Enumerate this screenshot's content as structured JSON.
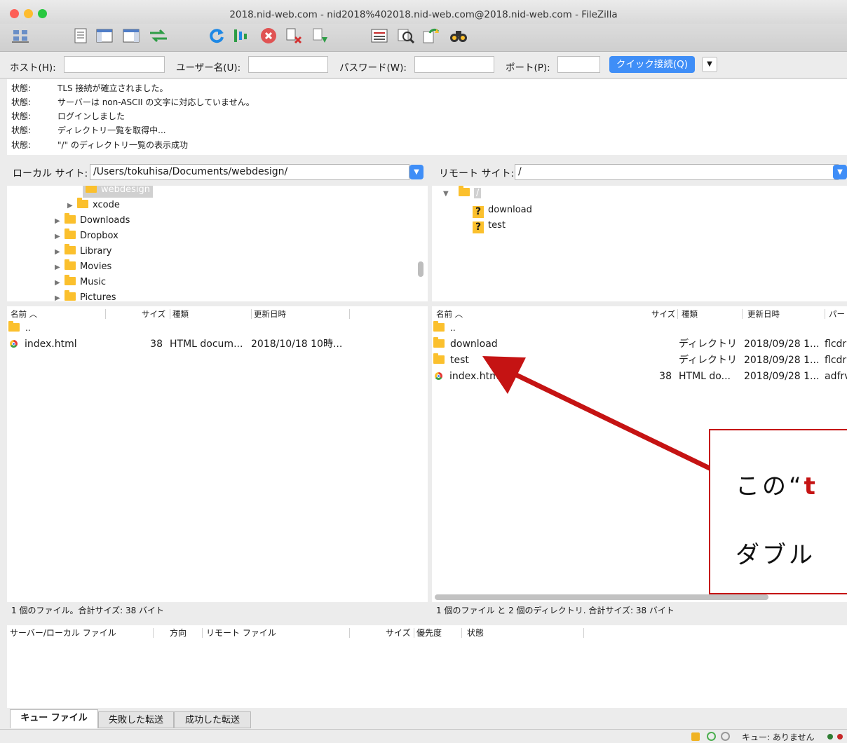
{
  "window": {
    "title": "2018.nid-web.com - nid2018%402018.nid-web.com@2018.nid-web.com - FileZilla"
  },
  "toolbar": {
    "icons": [
      "site-manager-icon",
      "toggle-log-icon",
      "toggle-local-tree-icon",
      "toggle-remote-tree-icon",
      "toggle-queue-icon",
      "refresh-icon",
      "process-queue-icon",
      "cancel-icon",
      "disconnect-icon",
      "reconnect-icon",
      "filter-icon",
      "compare-icon",
      "sync-browse-icon",
      "search-icon"
    ]
  },
  "quickconnect": {
    "host_label": "ホスト(H):",
    "user_label": "ユーザー名(U):",
    "password_label": "パスワード(W):",
    "port_label": "ポート(P):",
    "host_value": "",
    "user_value": "",
    "password_value": "",
    "port_value": "",
    "button_label": "クイック接続(Q)"
  },
  "log": [
    {
      "key": "状態:",
      "text": "TLS 接続が確立されました。"
    },
    {
      "key": "状態:",
      "text": "サーバーは non-ASCII の文字に対応していません。"
    },
    {
      "key": "状態:",
      "text": "ログインしました"
    },
    {
      "key": "状態:",
      "text": "ディレクトリ一覧を取得中..."
    },
    {
      "key": "状態:",
      "text": "\"/\" のディレクトリ一覧の表示成功"
    }
  ],
  "local": {
    "site_label": "ローカル サイト:",
    "site_path": "/Users/tokuhisa/Documents/webdesign/",
    "tree": [
      "webdesign",
      "xcode",
      "Downloads",
      "Dropbox",
      "Library",
      "Movies",
      "Music",
      "Pictures"
    ],
    "columns": {
      "name": "名前",
      "size": "サイズ",
      "type": "種類",
      "modified": "更新日時"
    },
    "files": [
      {
        "name": "..",
        "size": "",
        "type": "",
        "modified": ""
      },
      {
        "name": "index.html",
        "size": "38",
        "type": "HTML docum...",
        "modified": "2018/10/18 10時..."
      }
    ],
    "status": "1 個のファイル。合計サイズ: 38 バイト"
  },
  "remote": {
    "site_label": "リモート サイト:",
    "site_path": "/",
    "tree_root": "/",
    "tree": [
      "download",
      "test"
    ],
    "columns": {
      "name": "名前",
      "size": "サイズ",
      "type": "種類",
      "modified": "更新日時",
      "perm": "パー"
    },
    "files": [
      {
        "name": "..",
        "size": "",
        "type": "",
        "modified": "",
        "perm": ""
      },
      {
        "name": "download",
        "size": "",
        "type": "ディレクトリ",
        "modified": "2018/09/28 1...",
        "perm": "flcdr"
      },
      {
        "name": "test",
        "size": "",
        "type": "ディレクトリ",
        "modified": "2018/09/28 1...",
        "perm": "flcdr"
      },
      {
        "name": "index.html",
        "size": "38",
        "type": "HTML do...",
        "modified": "2018/09/28 1...",
        "perm": "adfrv"
      }
    ],
    "status": "1 個のファイル と 2 個のディレクトリ. 合計サイズ: 38 バイト"
  },
  "queue": {
    "columns": {
      "file": "サーバー/ローカル ファイル",
      "direction": "方向",
      "remote": "リモート ファイル",
      "size": "サイズ",
      "priority": "優先度",
      "status": "状態"
    },
    "tabs": [
      "キュー ファイル",
      "失敗した転送",
      "成功した転送"
    ],
    "status_text": "キュー: ありません"
  },
  "annotation": {
    "line1_prefix": "この",
    "line1_quote": "“",
    "line1_red": "t",
    "line2": "ダブル",
    "arrow_color": "#c51313"
  }
}
